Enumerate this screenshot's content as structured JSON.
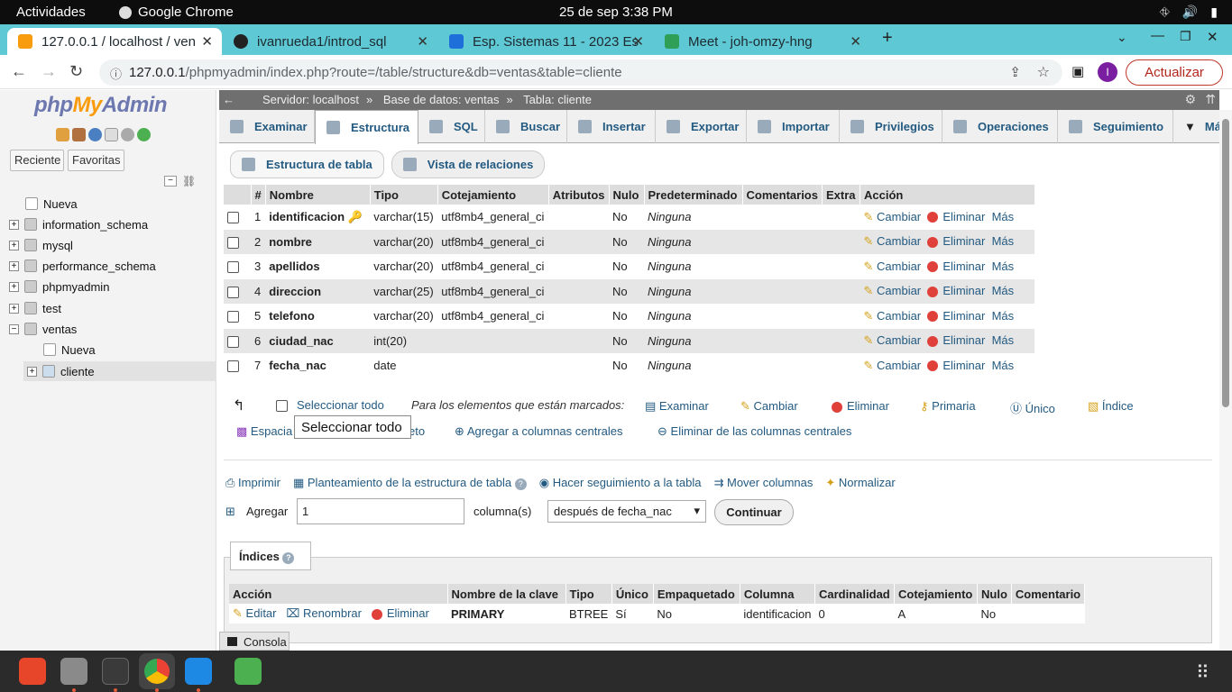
{
  "os": {
    "activities": "Actividades",
    "app_name": "Google Chrome",
    "clock": "25 de sep  3:38 PM"
  },
  "browser": {
    "tabs": [
      {
        "label": "127.0.0.1 / localhost / ven"
      },
      {
        "label": "ivanrueda1/introd_sql"
      },
      {
        "label": "Esp. Sistemas 11 - 2023 Es"
      },
      {
        "label": "Meet - joh-omzy-hng"
      }
    ],
    "url_host": "127.0.0.1",
    "url_path": "/phpmyadmin/index.php?route=/table/structure&db=ventas&table=cliente",
    "update_label": "Actualizar",
    "profile_initial": "I"
  },
  "sidebar": {
    "logo_php": "php",
    "logo_my": "My",
    "logo_admin": "Admin",
    "recent": "Reciente",
    "favorites": "Favoritas",
    "tree": [
      {
        "label": "Nueva"
      },
      {
        "label": "information_schema"
      },
      {
        "label": "mysql"
      },
      {
        "label": "performance_schema"
      },
      {
        "label": "phpmyadmin"
      },
      {
        "label": "test"
      },
      {
        "label": "ventas"
      },
      {
        "label": "Nueva"
      },
      {
        "label": "cliente"
      }
    ]
  },
  "breadcrumb": {
    "server": "Servidor: localhost",
    "sep": "»",
    "database": "Base de datos: ventas",
    "table": "Tabla: cliente"
  },
  "menu": {
    "tabs": [
      "Examinar",
      "Estructura",
      "SQL",
      "Buscar",
      "Insertar",
      "Exportar",
      "Importar",
      "Privilegios",
      "Operaciones",
      "Seguimiento",
      "Más"
    ]
  },
  "subtabs": {
    "structure": "Estructura de tabla",
    "relations": "Vista de relaciones"
  },
  "structure": {
    "headers": [
      "#",
      "Nombre",
      "Tipo",
      "Cotejamiento",
      "Atributos",
      "Nulo",
      "Predeterminado",
      "Comentarios",
      "Extra",
      "Acción"
    ],
    "rows": [
      {
        "num": "1",
        "name": "identificacion",
        "type": "varchar(15)",
        "collation": "utf8mb4_general_ci",
        "null": "No",
        "default": "Ninguna"
      },
      {
        "num": "2",
        "name": "nombre",
        "type": "varchar(20)",
        "collation": "utf8mb4_general_ci",
        "null": "No",
        "default": "Ninguna"
      },
      {
        "num": "3",
        "name": "apellidos",
        "type": "varchar(20)",
        "collation": "utf8mb4_general_ci",
        "null": "No",
        "default": "Ninguna"
      },
      {
        "num": "4",
        "name": "direccion",
        "type": "varchar(25)",
        "collation": "utf8mb4_general_ci",
        "null": "No",
        "default": "Ninguna"
      },
      {
        "num": "5",
        "name": "telefono",
        "type": "varchar(20)",
        "collation": "utf8mb4_general_ci",
        "null": "No",
        "default": "Ninguna"
      },
      {
        "num": "6",
        "name": "ciudad_nac",
        "type": "int(20)",
        "collation": "",
        "null": "No",
        "default": "Ninguna"
      },
      {
        "num": "7",
        "name": "fecha_nac",
        "type": "date",
        "collation": "",
        "null": "No",
        "default": "Ninguna"
      }
    ],
    "action_change": "Cambiar",
    "action_delete": "Eliminar",
    "action_more": "Más"
  },
  "bulk": {
    "select_all": "Seleccionar todo",
    "with_selected": "Para los elementos que están marcados:",
    "browse": "Examinar",
    "change": "Cambiar",
    "delete": "Eliminar",
    "primary": "Primaria",
    "unique": "Único",
    "index": "Índice",
    "spatial": "Espacia",
    "fulltext": "eto",
    "add_central": "Agregar a columnas centrales",
    "remove_central": "Eliminar de las columnas centrales",
    "tooltip": "Seleccionar todo"
  },
  "tools": {
    "print": "Imprimir",
    "propose": "Planteamiento de la estructura de tabla",
    "track": "Hacer seguimiento a la tabla",
    "move": "Mover columnas",
    "normalize": "Normalizar"
  },
  "add_columns": {
    "label": "Agregar",
    "count": "1",
    "suffix": "columna(s)",
    "position": "después de fecha_nac",
    "go": "Continuar"
  },
  "indexes": {
    "legend": "Índices",
    "headers": [
      "Acción",
      "Nombre de la clave",
      "Tipo",
      "Único",
      "Empaquetado",
      "Columna",
      "Cardinalidad",
      "Cotejamiento",
      "Nulo",
      "Comentario"
    ],
    "row": {
      "edit": "Editar",
      "rename": "Renombrar",
      "delete": "Eliminar",
      "key": "PRIMARY",
      "type": "BTREE",
      "unique": "Sí",
      "packed": "No",
      "column": "identificacion",
      "cardinality": "0",
      "collation": "A",
      "null": "No",
      "comment": ""
    }
  },
  "console": {
    "label": "Consola"
  },
  "colors": {
    "tab_strip": "#5ec8d4",
    "link": "#235a81",
    "logo_blue": "#6c78af",
    "logo_orange": "#f89c0e"
  }
}
